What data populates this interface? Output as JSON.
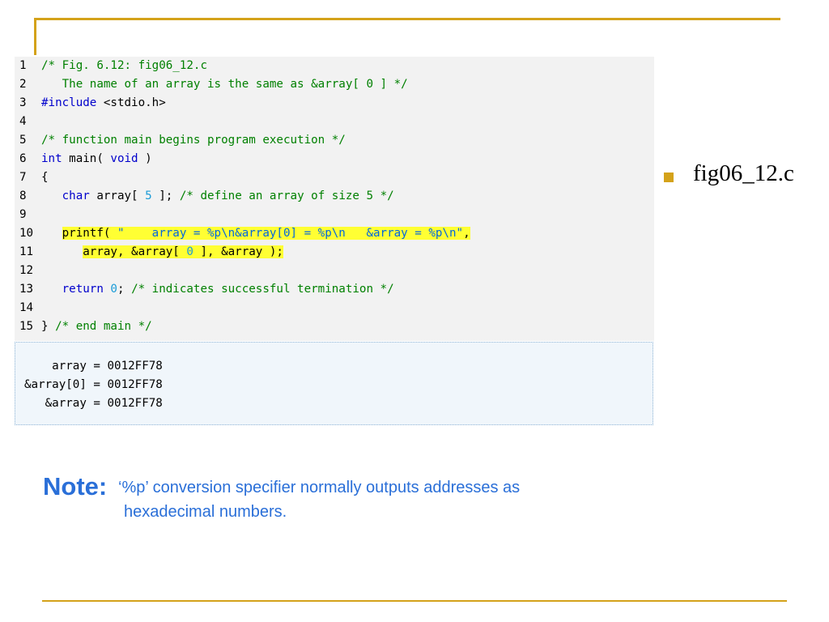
{
  "slide": {
    "bullet": "fig06_12.c",
    "note_label": "Note:",
    "note_line1": "‘%p’ conversion specifier normally outputs addresses as",
    "note_line2": "hexadecimal numbers."
  },
  "code": {
    "lines": [
      {
        "n": "1",
        "text": "/* Fig. 6.12: fig06_12.c"
      },
      {
        "n": "2",
        "text": "   The name of an array is the same as &array[ 0 ] */"
      },
      {
        "n": "3",
        "text": "#include <stdio.h>"
      },
      {
        "n": "4",
        "text": ""
      },
      {
        "n": "5",
        "text": "/* function main begins program execution */"
      },
      {
        "n": "6",
        "text": "int main( void )"
      },
      {
        "n": "7",
        "text": "{"
      },
      {
        "n": "8",
        "text": "   char array[ 5 ]; /* define an array of size 5 */"
      },
      {
        "n": "9",
        "text": ""
      },
      {
        "n": "10",
        "text": "   printf( \"    array = %p\\n&array[0] = %p\\n   &array = %p\\n\","
      },
      {
        "n": "11",
        "text": "      array, &array[ 0 ], &array );"
      },
      {
        "n": "12",
        "text": ""
      },
      {
        "n": "13",
        "text": "   return 0; /* indicates successful termination */"
      },
      {
        "n": "14",
        "text": ""
      },
      {
        "n": "15",
        "text": "} /* end main */"
      }
    ]
  },
  "output": {
    "lines": [
      "    array = 0012FF78",
      "&array[0] = 0012FF78",
      "   &array = 0012FF78"
    ]
  },
  "colors": {
    "accent": "#d4a21a",
    "note": "#2a6fd8",
    "keyword": "#0000cc",
    "comment": "#008000",
    "highlight": "#ffff33"
  }
}
